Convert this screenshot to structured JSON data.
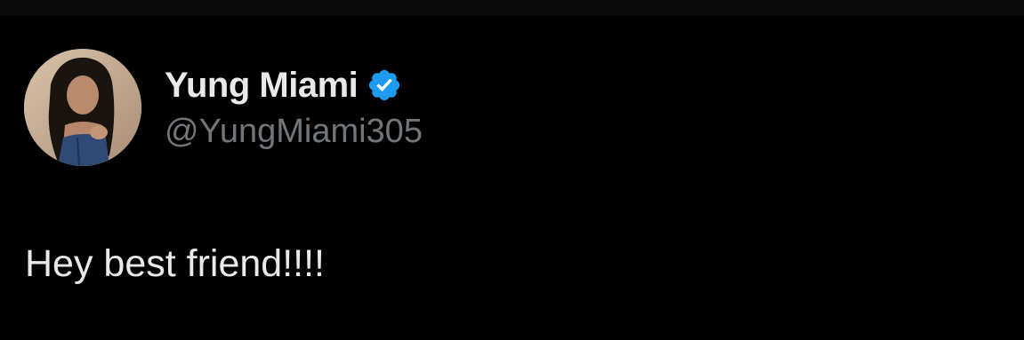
{
  "tweet": {
    "author": {
      "display_name": "Yung Miami",
      "handle": "@YungMiami305",
      "verified": true,
      "verified_badge_color": "#1d9bf0"
    },
    "text": "Hey best friend!!!!"
  },
  "colors": {
    "background": "#000000",
    "primary_text": "#e7e9ea",
    "secondary_text": "#71767b"
  }
}
